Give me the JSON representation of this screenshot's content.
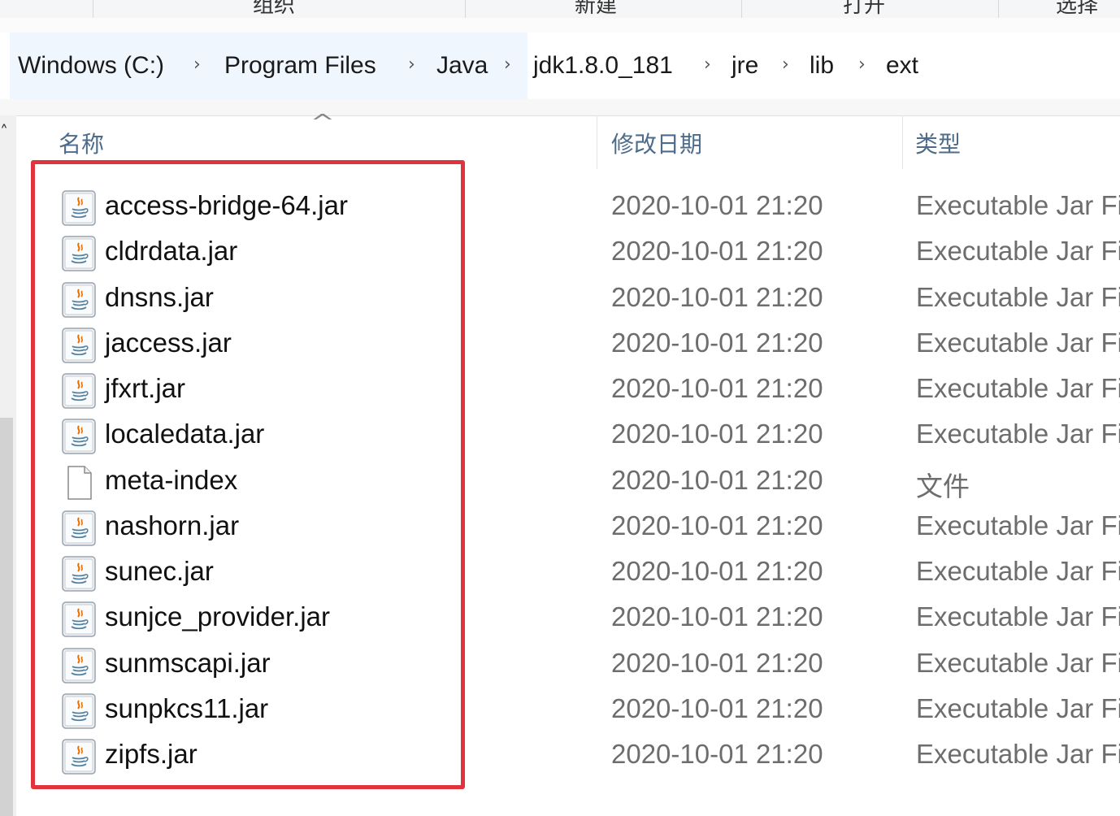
{
  "ribbon": {
    "groups": [
      "组织",
      "新建",
      "打开",
      "选择"
    ]
  },
  "breadcrumb": [
    {
      "label": "Windows (C:)"
    },
    {
      "label": "Program Files"
    },
    {
      "label": "Java"
    },
    {
      "label": "jdk1.8.0_181"
    },
    {
      "label": "jre"
    },
    {
      "label": "lib"
    },
    {
      "label": "ext"
    }
  ],
  "columns": {
    "name": "名称",
    "date": "修改日期",
    "type": "类型"
  },
  "files": [
    {
      "name": "access-bridge-64.jar",
      "date": "2020-10-01 21:20",
      "type": "Executable Jar Fi",
      "icon": "jar-file-icon"
    },
    {
      "name": "cldrdata.jar",
      "date": "2020-10-01 21:20",
      "type": "Executable Jar Fi",
      "icon": "jar-file-icon"
    },
    {
      "name": "dnsns.jar",
      "date": "2020-10-01 21:20",
      "type": "Executable Jar Fi",
      "icon": "jar-file-icon"
    },
    {
      "name": "jaccess.jar",
      "date": "2020-10-01 21:20",
      "type": "Executable Jar Fi",
      "icon": "jar-file-icon"
    },
    {
      "name": "jfxrt.jar",
      "date": "2020-10-01 21:20",
      "type": "Executable Jar Fi",
      "icon": "jar-file-icon"
    },
    {
      "name": "localedata.jar",
      "date": "2020-10-01 21:20",
      "type": "Executable Jar Fi",
      "icon": "jar-file-icon"
    },
    {
      "name": "meta-index",
      "date": "2020-10-01 21:20",
      "type": "文件",
      "icon": "blank-file-icon"
    },
    {
      "name": "nashorn.jar",
      "date": "2020-10-01 21:20",
      "type": "Executable Jar Fi",
      "icon": "jar-file-icon"
    },
    {
      "name": "sunec.jar",
      "date": "2020-10-01 21:20",
      "type": "Executable Jar Fi",
      "icon": "jar-file-icon"
    },
    {
      "name": "sunjce_provider.jar",
      "date": "2020-10-01 21:20",
      "type": "Executable Jar Fi",
      "icon": "jar-file-icon"
    },
    {
      "name": "sunmscapi.jar",
      "date": "2020-10-01 21:20",
      "type": "Executable Jar Fi",
      "icon": "jar-file-icon"
    },
    {
      "name": "sunpkcs11.jar",
      "date": "2020-10-01 21:20",
      "type": "Executable Jar Fi",
      "icon": "jar-file-icon"
    },
    {
      "name": "zipfs.jar",
      "date": "2020-10-01 21:20",
      "type": "Executable Jar Fi",
      "icon": "jar-file-icon"
    }
  ],
  "colors": {
    "highlight_border": "#e0333d",
    "header_text": "#4d6b8a",
    "secondary_text": "#6d6d6d"
  }
}
